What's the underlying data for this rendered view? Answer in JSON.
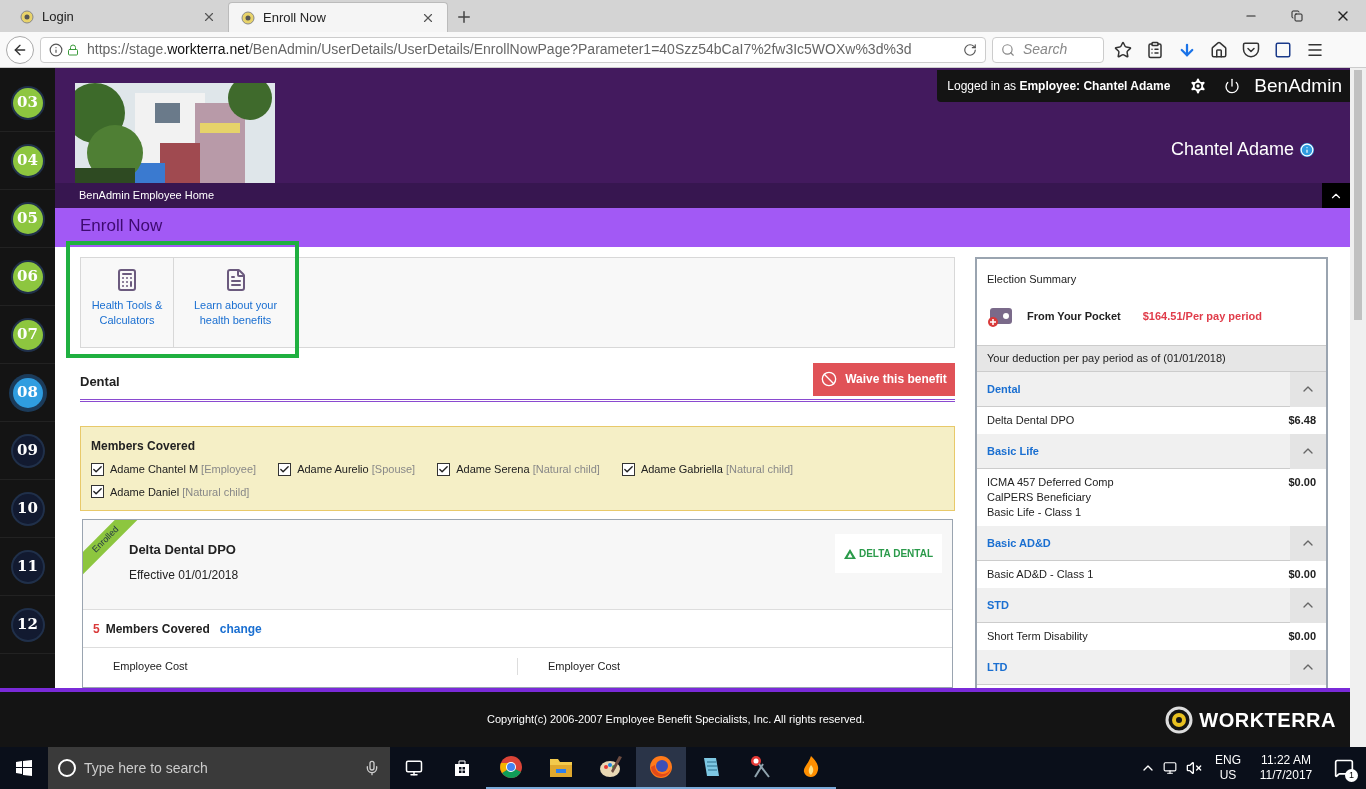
{
  "browser": {
    "tabs": [
      {
        "label": "Login",
        "selected": false
      },
      {
        "label": "Enroll Now",
        "selected": true
      }
    ],
    "url_prefix": "https://stage.",
    "url_domain": "workterra.net",
    "url_path": "/BenAdmin/UserDetails/UserDetails/EnrollNowPage?Parameter1=40Szz54bCaI7%2fw3Ic5WOXw%3d%3d",
    "search_placeholder": "Search"
  },
  "steps": [
    {
      "label": "03",
      "color": "#8dc63f",
      "selected": false
    },
    {
      "label": "04",
      "color": "#8dc63f",
      "selected": false
    },
    {
      "label": "05",
      "color": "#8dc63f",
      "selected": false
    },
    {
      "label": "06",
      "color": "#8dc63f",
      "selected": false
    },
    {
      "label": "07",
      "color": "#8dc63f",
      "selected": false
    },
    {
      "label": "08",
      "color": "#2f9de0",
      "selected": true
    },
    {
      "label": "09",
      "color": "#121a30",
      "selected": false
    },
    {
      "label": "10",
      "color": "#121a30",
      "selected": false
    },
    {
      "label": "11",
      "color": "#121a30",
      "selected": false
    },
    {
      "label": "12",
      "color": "#121a30",
      "selected": false
    }
  ],
  "header": {
    "logged_in_prefix": "Logged in as ",
    "role": "Employee:",
    "user": "Chantel Adame",
    "app_name": "BenAdmin",
    "display_name": "Chantel Adame",
    "breadcrumb": "BenAdmin Employee Home"
  },
  "page_title": "Enroll Now",
  "tools": [
    {
      "kind": "calculator",
      "label": "Health Tools & Calculators"
    },
    {
      "kind": "document",
      "label": "Learn about your health benefits"
    }
  ],
  "benefit": {
    "title": "Dental",
    "waive_button": "Waive this benefit"
  },
  "members": {
    "title": "Members Covered",
    "items": [
      {
        "name": "Adame Chantel M",
        "relation": "[Employee]",
        "checked": true
      },
      {
        "name": "Adame Aurelio",
        "relation": "[Spouse]",
        "checked": true
      },
      {
        "name": "Adame Serena",
        "relation": "[Natural child]",
        "checked": true
      },
      {
        "name": "Adame Gabriella",
        "relation": "[Natural child]",
        "checked": true
      },
      {
        "name": "Adame Daniel",
        "relation": "[Natural child]",
        "checked": true
      }
    ]
  },
  "plan": {
    "ribbon": "Enrolled",
    "name": "Delta Dental DPO",
    "effective": "Effective 01/01/2018",
    "logo_text": "DELTA DENTAL",
    "members_count": "5",
    "members_label": "Members Covered",
    "change_link": "change",
    "cost_columns": [
      "Employee Cost",
      "Employer Cost"
    ]
  },
  "summary": {
    "title": "Election Summary",
    "pocket_label": "From Your Pocket",
    "pocket_amount": "$164.51/Per pay period",
    "deduction_note": "Your deduction per pay period as of (01/01/2018)",
    "sections": [
      {
        "title": "Dental",
        "expanded": true,
        "items": [
          {
            "lines": [
              "Delta Dental DPO"
            ],
            "amount": "$6.48"
          }
        ]
      },
      {
        "title": "Basic Life",
        "expanded": true,
        "items": [
          {
            "lines": [
              "ICMA 457 Deferred Comp",
              "CalPERS Beneficiary",
              "Basic Life - Class 1"
            ],
            "amount": "$0.00"
          }
        ]
      },
      {
        "title": "Basic AD&D",
        "expanded": true,
        "items": [
          {
            "lines": [
              "Basic AD&D - Class 1"
            ],
            "amount": "$0.00"
          }
        ]
      },
      {
        "title": "STD",
        "expanded": true,
        "items": [
          {
            "lines": [
              "Short Term Disability"
            ],
            "amount": "$0.00"
          }
        ]
      },
      {
        "title": "LTD",
        "expanded": true
      }
    ]
  },
  "footer": {
    "copyright": "Copyright(c) 2006-2007 Employee Benefit Specialists, Inc. All rights reserved.",
    "brand": "WORKTERRA"
  },
  "taskbar": {
    "search_placeholder": "Type here to search",
    "apps": [
      {
        "kind": "chrome",
        "active": false
      },
      {
        "kind": "folder",
        "active": false
      },
      {
        "kind": "paint",
        "active": false
      },
      {
        "kind": "firefox",
        "active": true
      },
      {
        "kind": "notepad",
        "active": false
      },
      {
        "kind": "snip",
        "active": false
      },
      {
        "kind": "flame",
        "active": false
      }
    ],
    "language": "ENG",
    "region": "US",
    "time": "11:22 AM",
    "date": "11/7/2017",
    "notifications": "1"
  }
}
